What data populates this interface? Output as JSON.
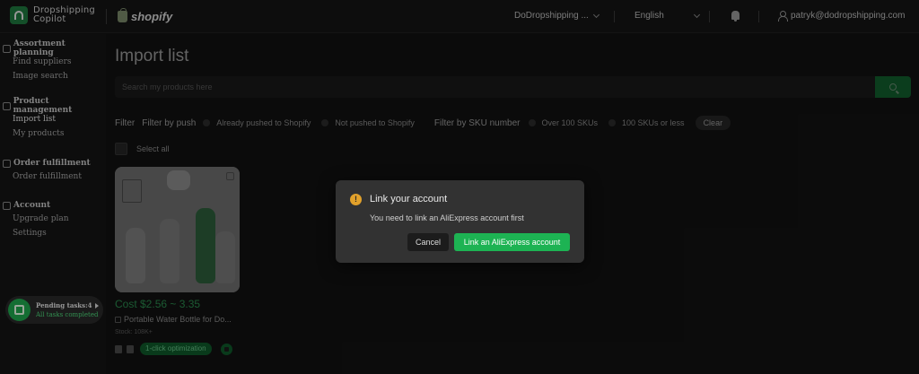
{
  "brand": {
    "line1": "Dropshipping",
    "line2": "Copilot",
    "icon": "copilot-logo-icon"
  },
  "platform": {
    "name": "shopify",
    "icon": "shopify-bag-icon"
  },
  "header": {
    "store": "DoDropshipping ...",
    "language": "English",
    "user_email": "patryk@dodropshipping.com",
    "bell_icon": "bell-icon",
    "user_icon": "user-icon"
  },
  "sidebar": {
    "groups": [
      {
        "title": "Assortment planning",
        "icon": "grid-icon",
        "items": [
          "Find suppliers",
          "Image search"
        ]
      },
      {
        "title": "Product management",
        "icon": "box-icon",
        "items": [
          "Import list",
          "My products"
        ]
      },
      {
        "title": "Order fulfillment",
        "icon": "truck-icon",
        "items": [
          "Order fulfillment"
        ]
      },
      {
        "title": "Account",
        "icon": "gear-icon",
        "items": [
          "Upgrade plan",
          "Settings"
        ]
      }
    ],
    "active_item": "Import list"
  },
  "pending": {
    "title": "Pending tasks:4",
    "status": "All tasks completed"
  },
  "main": {
    "title": "Import list",
    "search_placeholder": "Search my products here",
    "filter_label": "Filter",
    "filter_by_push": "Filter by push",
    "opt_pushed": "Already pushed to Shopify",
    "opt_not_pushed": "Not pushed to Shopify",
    "filter_by_sku": "Filter by SKU number",
    "opt_over_100": "Over 100 SKUs",
    "opt_100_or_less": "100 SKUs or less",
    "clear": "Clear",
    "select_all": "Select all"
  },
  "product": {
    "cost": "Cost $2.56 ~ 3.35",
    "name": "Portable Water Bottle for Do...",
    "stock": "Stock: 108K+",
    "optimize": "1-click optimization"
  },
  "modal": {
    "title": "Link your account",
    "message": "You need to link an AliExpress account first",
    "cancel": "Cancel",
    "confirm": "Link an AliExpress account",
    "warn_icon": "!"
  },
  "colors": {
    "accent": "#1db353",
    "warning": "#e2a12b",
    "background": "#121212"
  }
}
